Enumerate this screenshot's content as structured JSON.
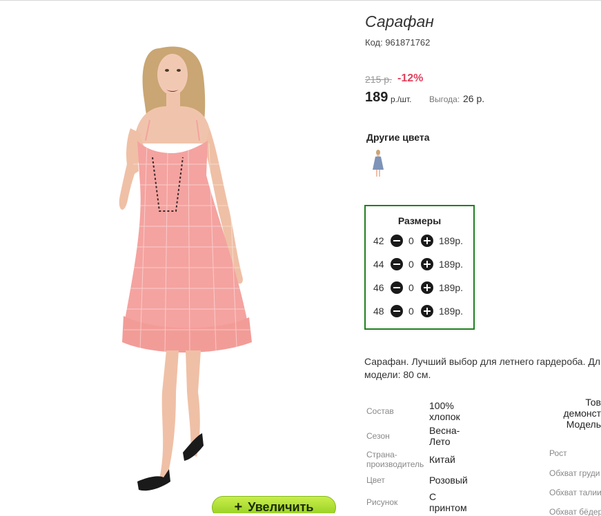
{
  "product": {
    "title": "Сарафан",
    "code": "Код: 961871762",
    "old_price": "215 р.",
    "discount": "-12%",
    "price": "189",
    "price_unit": "р./шт.",
    "benefit_label": "Выгода:",
    "benefit_value": "26 р.",
    "zoom_button": "Увеличить",
    "zoom_plus": "+"
  },
  "other_colors": {
    "title": "Другие цвета"
  },
  "sizes": {
    "title": "Размеры",
    "rows": [
      {
        "size": "42",
        "qty": "0",
        "price": "189р."
      },
      {
        "size": "44",
        "qty": "0",
        "price": "189р."
      },
      {
        "size": "46",
        "qty": "0",
        "price": "189р."
      },
      {
        "size": "48",
        "qty": "0",
        "price": "189р."
      }
    ]
  },
  "description": {
    "line1": "Сарафан. Лучший выбор для летнего гардероба. Дл",
    "line2": "модели: 80 см."
  },
  "properties": [
    {
      "label": "Состав",
      "value1": "100%",
      "value2": "хлопок"
    },
    {
      "label": "Сезон",
      "value1": "Весна-",
      "value2": "Лето"
    },
    {
      "label1": "Страна-",
      "label2": "производитель",
      "value": "Китай"
    },
    {
      "label": "Цвет",
      "value": "Розовый"
    },
    {
      "label": "Рисунок",
      "value1": "С",
      "value2": "принтом"
    }
  ],
  "model_note": {
    "line1": "Тов",
    "line2": "демонст",
    "line3": "Модель"
  },
  "measurements": {
    "rost": "Рост",
    "chest": "Обхват груди",
    "waist": "Обхват талии",
    "hips": "Обхват бёдер"
  },
  "colors": {
    "accent_green": "#1f7f1f",
    "discount_red": "#e2405c",
    "button_green": "#a6dc2a"
  }
}
